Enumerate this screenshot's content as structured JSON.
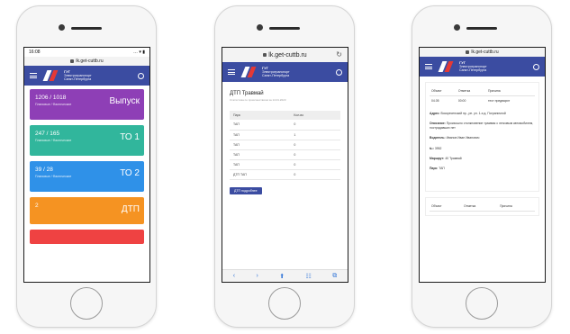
{
  "phone1": {
    "time": "16:08",
    "signal": "… ▾ ▮",
    "url": "lk.get-cuttb.ru",
    "brand_short": "ГУГ",
    "brand_lines": [
      "Электротранспорт",
      "Санкт-Петербурга"
    ],
    "cards": [
      {
        "count": "1206 / 1018",
        "sub": "Плановые / Фактические",
        "title": "Выпуск",
        "color": "#8e3fb6"
      },
      {
        "count": "247 / 165",
        "sub": "Плановые / Фактические",
        "title": "ТО 1",
        "color": "#31b69c"
      },
      {
        "count": "39 / 28",
        "sub": "Плановые / Фактические",
        "title": "ТО 2",
        "color": "#2f91e8"
      },
      {
        "count": "2",
        "sub": "",
        "title": "ДТП",
        "color": "#f59322"
      }
    ]
  },
  "phone2": {
    "url": "lk.get-cuttb.ru",
    "title": "ДТП Травмай",
    "note": "Статистика по происшествиям за 14.01.2023",
    "table": {
      "headers": [
        "Парк",
        "Кол-во"
      ],
      "rows": [
        [
          "ТАП",
          "0"
        ],
        [
          "ТАП",
          "1"
        ],
        [
          "ТАП",
          "0"
        ],
        [
          "ТАП",
          "0"
        ],
        [
          "ТАП",
          "0"
        ],
        [
          "ДТП ТАП",
          "0"
        ]
      ]
    },
    "button_label": "ДТП подробнее",
    "toolbar": [
      "‹",
      "›",
      "⬆",
      "☷",
      "⧉"
    ]
  },
  "phone3": {
    "url": "lk.get-cuttb.ru",
    "table": {
      "headers": [
        "Объект",
        "Отметка",
        "Причина"
      ],
      "rows": [
        [
          "04.05",
          "00:00",
          "тест предварит"
        ]
      ]
    },
    "fields": [
      {
        "label": "Адрес:",
        "value": "Воскресенский пр., рн. ул. 1-я д. Пограничной"
      },
      {
        "label": "Описание:",
        "value": "Произошло столкновение трамвая с легковым автомобилем, пострадавших нет"
      },
      {
        "label": "Водитель:",
        "value": "Иванов Иван Иванович"
      },
      {
        "label": "№:",
        "value": "3952"
      },
      {
        "label": "Маршрут:",
        "value": "40 Трамвай"
      },
      {
        "label": "Парк:",
        "value": "ТАП"
      }
    ],
    "table2": {
      "headers": [
        "Объект",
        "Отметка",
        "Причина"
      ]
    }
  }
}
